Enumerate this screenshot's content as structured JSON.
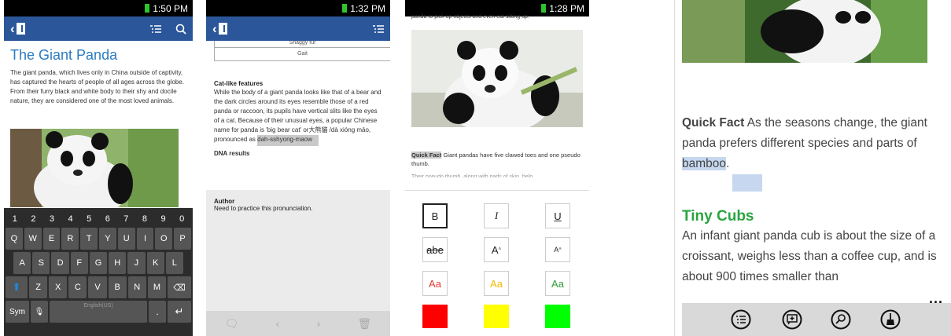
{
  "p1": {
    "time": "1:50 PM",
    "title": "The Giant Panda",
    "body": "The giant panda, which lives only in China outside of captivity, has captured the hearts of people of all ages across the globe. From their furry black and white body to their shy and docile nature, they are considered one of the most loved animals.",
    "kb": {
      "nums": [
        "1",
        "2",
        "3",
        "4",
        "5",
        "6",
        "7",
        "8",
        "9",
        "0"
      ],
      "r1": [
        "Q",
        "W",
        "E",
        "R",
        "T",
        "Y",
        "U",
        "I",
        "O",
        "P"
      ],
      "r2": [
        "A",
        "S",
        "D",
        "F",
        "G",
        "H",
        "J",
        "K",
        "L"
      ],
      "r3": [
        "Z",
        "X",
        "C",
        "V",
        "B",
        "N",
        "M"
      ],
      "sym": "Sym",
      "space": "English(US)"
    }
  },
  "p2": {
    "time": "1:32 PM",
    "row1": "Shaggy fur",
    "row2": "Gait",
    "heading": "Cat-like features",
    "body": "While the body of a giant panda looks like that of a bear and the dark circles around its eyes resemble those of a red panda or raccoon, its pupils have vertical slits like the eyes of a cat. Because of their unusual eyes, a popular Chinese name for panda is 'big bear cat' or大熊貓 /dà xióng māo, pronounced as ",
    "hl": "dah-sshyong-maow",
    "cut": "DNA results",
    "author": "Author",
    "comment": "Need to practice this pronunciation."
  },
  "p3": {
    "time": "1:28 PM",
    "top": "panda to pick up objects and even eat sitting up.",
    "qf": "Quick Fact",
    "fact": " Giant pandas have five clawed toes and one pseudo thumb.",
    "cut": "Their pseudo thumb, along with pads of skin, help",
    "btn": [
      "B",
      "I",
      "U",
      "abe",
      "A",
      "A",
      "Aa",
      "Aa",
      "Aa"
    ],
    "swatches": [
      "#ff0000",
      "#ffff00",
      "#00ff00"
    ],
    "colors": [
      "#e53935",
      "#f5b700",
      "#2e9c3a"
    ]
  },
  "p4": {
    "qfl": "Quick Fact",
    "qft": " As the seasons change, the giant panda prefers different species and parts of ",
    "qfw": "bamboo",
    "dot": ".",
    "h": "Tiny Cubs",
    "body": "An infant giant panda cub is about the size of a croissant, weighs less than a coffee cup, and is about 900 times smaller than",
    "more": "..."
  }
}
